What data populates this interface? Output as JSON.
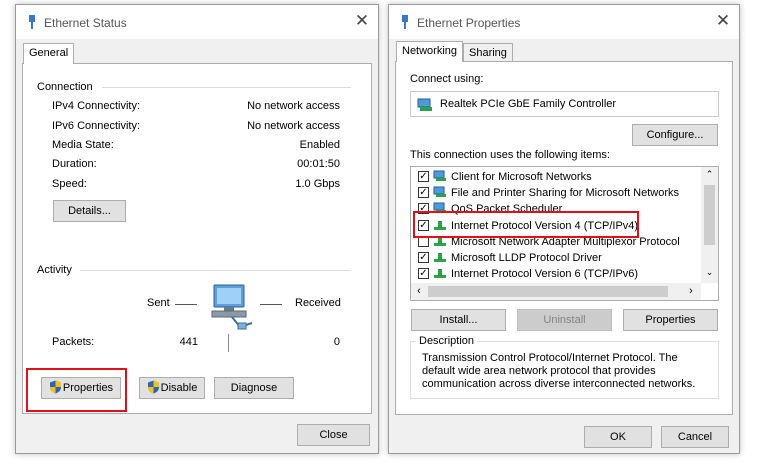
{
  "status_window": {
    "title": "Ethernet Status",
    "tab": "General",
    "connection": {
      "heading": "Connection",
      "rows": [
        {
          "label": "IPv4 Connectivity:",
          "value": "No network access"
        },
        {
          "label": "IPv6 Connectivity:",
          "value": "No network access"
        },
        {
          "label": "Media State:",
          "value": "Enabled"
        },
        {
          "label": "Duration:",
          "value": "00:01:50"
        },
        {
          "label": "Speed:",
          "value": "1.0 Gbps"
        }
      ],
      "details_button": "Details..."
    },
    "activity": {
      "heading": "Activity",
      "sent_label": "Sent",
      "received_label": "Received",
      "packets_label": "Packets:",
      "packets_sent": "441",
      "packets_received": "0"
    },
    "buttons": {
      "properties": "Properties",
      "disable": "Disable",
      "diagnose": "Diagnose",
      "close": "Close"
    }
  },
  "properties_window": {
    "title": "Ethernet Properties",
    "tabs": [
      "Networking",
      "Sharing"
    ],
    "connect_using_label": "Connect using:",
    "adapter_name": "Realtek PCIe GbE Family Controller",
    "configure_button": "Configure...",
    "items_label": "This connection uses the following items:",
    "items": [
      {
        "label": "Client for Microsoft Networks",
        "checked": true,
        "icon": "network-client-icon"
      },
      {
        "label": "File and Printer Sharing for Microsoft Networks",
        "checked": true,
        "icon": "network-client-icon"
      },
      {
        "label": "QoS Packet Scheduler",
        "checked": true,
        "icon": "network-client-icon"
      },
      {
        "label": "Internet Protocol Version 4 (TCP/IPv4)",
        "checked": true,
        "icon": "protocol-icon"
      },
      {
        "label": "Microsoft Network Adapter Multiplexor Protocol",
        "checked": false,
        "icon": "protocol-icon"
      },
      {
        "label": "Microsoft LLDP Protocol Driver",
        "checked": true,
        "icon": "protocol-icon"
      },
      {
        "label": "Internet Protocol Version 6 (TCP/IPv6)",
        "checked": true,
        "icon": "protocol-icon"
      }
    ],
    "install_button": "Install...",
    "uninstall_button": "Uninstall",
    "properties_button": "Properties",
    "description_heading": "Description",
    "description_text": "Transmission Control Protocol/Internet Protocol. The default wide area network protocol that provides communication across diverse interconnected networks.",
    "ok_button": "OK",
    "cancel_button": "Cancel"
  },
  "colors": {
    "highlight_red": "#e0101b",
    "window_bg": "#f0f0f0",
    "accent_green": "#2aa14a",
    "accent_blue": "#1f7bd0"
  }
}
